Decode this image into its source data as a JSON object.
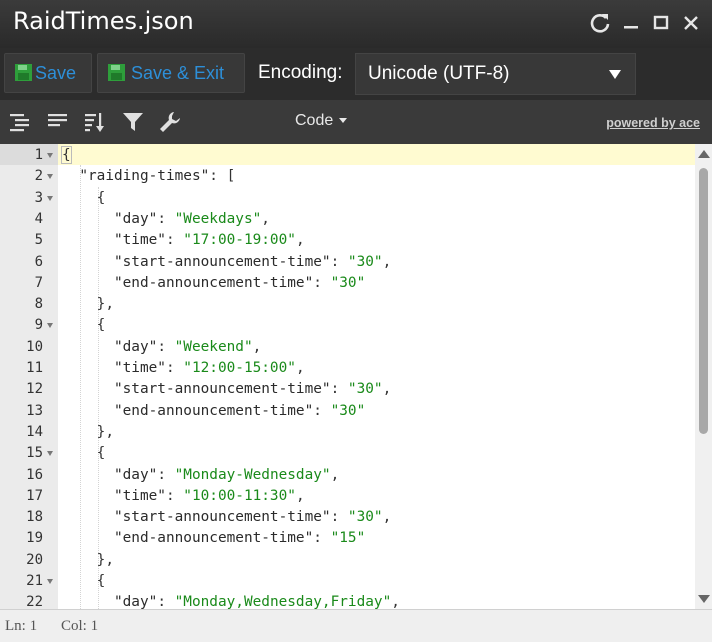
{
  "window": {
    "title": "RaidTimes.json",
    "controls": [
      "refresh-icon",
      "minimize-icon",
      "maximize-icon",
      "close-icon"
    ]
  },
  "toolbar": {
    "save_label": "Save",
    "save_exit_label": "Save & Exit",
    "encoding_label": "Encoding:",
    "encoding_value": "Unicode (UTF-8)",
    "accent_color": "#2d8fd8",
    "save_icon_color": "#2e9e3b"
  },
  "ace_toolbar": {
    "icons": [
      "indent-icon",
      "format-icon",
      "sort-icon",
      "filter-icon",
      "wrench-icon"
    ],
    "mode_label": "Code",
    "powered_by": "powered by ace"
  },
  "editor": {
    "active_line": 1,
    "lines": [
      {
        "n": "1",
        "fold": true,
        "indent": 0,
        "tokens": [
          {
            "t": "p",
            "v": "{"
          }
        ]
      },
      {
        "n": "2",
        "fold": true,
        "indent": 1,
        "tokens": [
          {
            "t": "k",
            "v": "\"raiding-times\""
          },
          {
            "t": "p",
            "v": ": ["
          }
        ]
      },
      {
        "n": "3",
        "fold": true,
        "indent": 2,
        "tokens": [
          {
            "t": "p",
            "v": "{"
          }
        ]
      },
      {
        "n": "4",
        "fold": false,
        "indent": 3,
        "tokens": [
          {
            "t": "k",
            "v": "\"day\""
          },
          {
            "t": "p",
            "v": ": "
          },
          {
            "t": "s",
            "v": "\"Weekdays\""
          },
          {
            "t": "p",
            "v": ","
          }
        ]
      },
      {
        "n": "5",
        "fold": false,
        "indent": 3,
        "tokens": [
          {
            "t": "k",
            "v": "\"time\""
          },
          {
            "t": "p",
            "v": ": "
          },
          {
            "t": "s",
            "v": "\"17:00-19:00\""
          },
          {
            "t": "p",
            "v": ","
          }
        ]
      },
      {
        "n": "6",
        "fold": false,
        "indent": 3,
        "tokens": [
          {
            "t": "k",
            "v": "\"start-announcement-time\""
          },
          {
            "t": "p",
            "v": ": "
          },
          {
            "t": "s",
            "v": "\"30\""
          },
          {
            "t": "p",
            "v": ","
          }
        ]
      },
      {
        "n": "7",
        "fold": false,
        "indent": 3,
        "tokens": [
          {
            "t": "k",
            "v": "\"end-announcement-time\""
          },
          {
            "t": "p",
            "v": ": "
          },
          {
            "t": "s",
            "v": "\"30\""
          }
        ]
      },
      {
        "n": "8",
        "fold": false,
        "indent": 2,
        "tokens": [
          {
            "t": "p",
            "v": "},"
          }
        ]
      },
      {
        "n": "9",
        "fold": true,
        "indent": 2,
        "tokens": [
          {
            "t": "p",
            "v": "{"
          }
        ]
      },
      {
        "n": "10",
        "fold": false,
        "indent": 3,
        "tokens": [
          {
            "t": "k",
            "v": "\"day\""
          },
          {
            "t": "p",
            "v": ": "
          },
          {
            "t": "s",
            "v": "\"Weekend\""
          },
          {
            "t": "p",
            "v": ","
          }
        ]
      },
      {
        "n": "11",
        "fold": false,
        "indent": 3,
        "tokens": [
          {
            "t": "k",
            "v": "\"time\""
          },
          {
            "t": "p",
            "v": ": "
          },
          {
            "t": "s",
            "v": "\"12:00-15:00\""
          },
          {
            "t": "p",
            "v": ","
          }
        ]
      },
      {
        "n": "12",
        "fold": false,
        "indent": 3,
        "tokens": [
          {
            "t": "k",
            "v": "\"start-announcement-time\""
          },
          {
            "t": "p",
            "v": ": "
          },
          {
            "t": "s",
            "v": "\"30\""
          },
          {
            "t": "p",
            "v": ","
          }
        ]
      },
      {
        "n": "13",
        "fold": false,
        "indent": 3,
        "tokens": [
          {
            "t": "k",
            "v": "\"end-announcement-time\""
          },
          {
            "t": "p",
            "v": ": "
          },
          {
            "t": "s",
            "v": "\"30\""
          }
        ]
      },
      {
        "n": "14",
        "fold": false,
        "indent": 2,
        "tokens": [
          {
            "t": "p",
            "v": "},"
          }
        ]
      },
      {
        "n": "15",
        "fold": true,
        "indent": 2,
        "tokens": [
          {
            "t": "p",
            "v": "{"
          }
        ]
      },
      {
        "n": "16",
        "fold": false,
        "indent": 3,
        "tokens": [
          {
            "t": "k",
            "v": "\"day\""
          },
          {
            "t": "p",
            "v": ": "
          },
          {
            "t": "s",
            "v": "\"Monday-Wednesday\""
          },
          {
            "t": "p",
            "v": ","
          }
        ]
      },
      {
        "n": "17",
        "fold": false,
        "indent": 3,
        "tokens": [
          {
            "t": "k",
            "v": "\"time\""
          },
          {
            "t": "p",
            "v": ": "
          },
          {
            "t": "s",
            "v": "\"10:00-11:30\""
          },
          {
            "t": "p",
            "v": ","
          }
        ]
      },
      {
        "n": "18",
        "fold": false,
        "indent": 3,
        "tokens": [
          {
            "t": "k",
            "v": "\"start-announcement-time\""
          },
          {
            "t": "p",
            "v": ": "
          },
          {
            "t": "s",
            "v": "\"30\""
          },
          {
            "t": "p",
            "v": ","
          }
        ]
      },
      {
        "n": "19",
        "fold": false,
        "indent": 3,
        "tokens": [
          {
            "t": "k",
            "v": "\"end-announcement-time\""
          },
          {
            "t": "p",
            "v": ": "
          },
          {
            "t": "s",
            "v": "\"15\""
          }
        ]
      },
      {
        "n": "20",
        "fold": false,
        "indent": 2,
        "tokens": [
          {
            "t": "p",
            "v": "},"
          }
        ]
      },
      {
        "n": "21",
        "fold": true,
        "indent": 2,
        "tokens": [
          {
            "t": "p",
            "v": "{"
          }
        ]
      },
      {
        "n": "22",
        "fold": false,
        "indent": 3,
        "tokens": [
          {
            "t": "k",
            "v": "\"day\""
          },
          {
            "t": "p",
            "v": ": "
          },
          {
            "t": "s",
            "v": "\"Monday,Wednesday,Friday\""
          },
          {
            "t": "p",
            "v": ","
          }
        ]
      }
    ]
  },
  "status": {
    "line": "Ln: 1",
    "col": "Col: 1"
  }
}
